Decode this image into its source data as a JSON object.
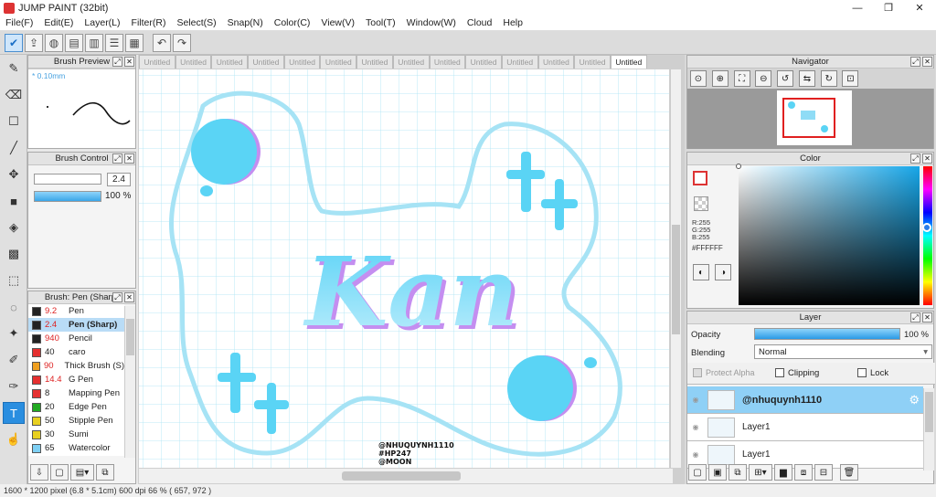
{
  "window": {
    "title": "JUMP PAINT (32bit)",
    "min": "—",
    "max": "❐",
    "close": "✕"
  },
  "menu": [
    "File(F)",
    "Edit(E)",
    "Layer(L)",
    "Filter(R)",
    "Select(S)",
    "Snap(N)",
    "Color(C)",
    "View(V)",
    "Tool(T)",
    "Window(W)",
    "Cloud",
    "Help"
  ],
  "brush_preview": {
    "title": "Brush Preview",
    "size_label": "* 0.10mm"
  },
  "brush_control": {
    "title": "Brush Control",
    "size_value": "2.4",
    "opacity_value": "100 %",
    "opacity_fraction": 1.0
  },
  "brush_list": {
    "title": "Brush: Pen (Sharp)",
    "items": [
      {
        "size": "9.2",
        "name": "Pen",
        "color": "#222222",
        "selected": false
      },
      {
        "size": "2.4",
        "name": "Pen (Sharp)",
        "color": "#222222",
        "selected": true
      },
      {
        "size": "940",
        "name": "Pencil",
        "color": "#222222",
        "selected": false
      },
      {
        "size": "40",
        "name": "caro",
        "color": "#e53030",
        "selected": false
      },
      {
        "size": "90",
        "name": "Thick Brush (S)",
        "color": "#f0a020",
        "selected": false
      },
      {
        "size": "14.4",
        "name": "G Pen",
        "color": "#e53030",
        "selected": false
      },
      {
        "size": "8",
        "name": "Mapping Pen",
        "color": "#e53030",
        "selected": false
      },
      {
        "size": "20",
        "name": "Edge Pen",
        "color": "#22aa22",
        "selected": false
      },
      {
        "size": "50",
        "name": "Stipple Pen",
        "color": "#e8d020",
        "selected": false
      },
      {
        "size": "30",
        "name": "Sumi",
        "color": "#e8d020",
        "selected": false
      },
      {
        "size": "65",
        "name": "Watercolor",
        "color": "#7fd0f4",
        "selected": false
      }
    ]
  },
  "tabs": [
    "Untitled",
    "Untitled",
    "Untitled",
    "Untitled",
    "Untitled",
    "Untitled",
    "Untitled",
    "Untitled",
    "Untitled",
    "Untitled",
    "Untitled",
    "Untitled",
    "Untitled",
    "Untitled"
  ],
  "canvas": {
    "art_text": "Kan",
    "watermark": [
      "@NHUQUYNH1110",
      "#HP247",
      "@MOON"
    ],
    "art_color": "#5ad4f5",
    "accent_color": "#c48ef0"
  },
  "navigator": {
    "title": "Navigator"
  },
  "color_panel": {
    "title": "Color",
    "r": "R:255",
    "g": "G:255",
    "b": "B:255",
    "hex": "#FFFFFF"
  },
  "layer_panel": {
    "title": "Layer",
    "opacity_label": "Opacity",
    "opacity_value": "100 %",
    "opacity_fraction": 1.0,
    "blending_label": "Blending",
    "blending_value": "Normal",
    "protect_alpha": "Protect Alpha",
    "clipping": "Clipping",
    "lock": "Lock",
    "layers": [
      {
        "name": "@nhuquynh1110",
        "selected": true
      },
      {
        "name": "Layer1",
        "selected": false
      },
      {
        "name": "Layer1",
        "selected": false
      }
    ]
  },
  "status": {
    "text": "1600 * 1200 pixel   (6.8 * 5.1cm)   600 dpi   66 %   ( 657, 972 )"
  }
}
